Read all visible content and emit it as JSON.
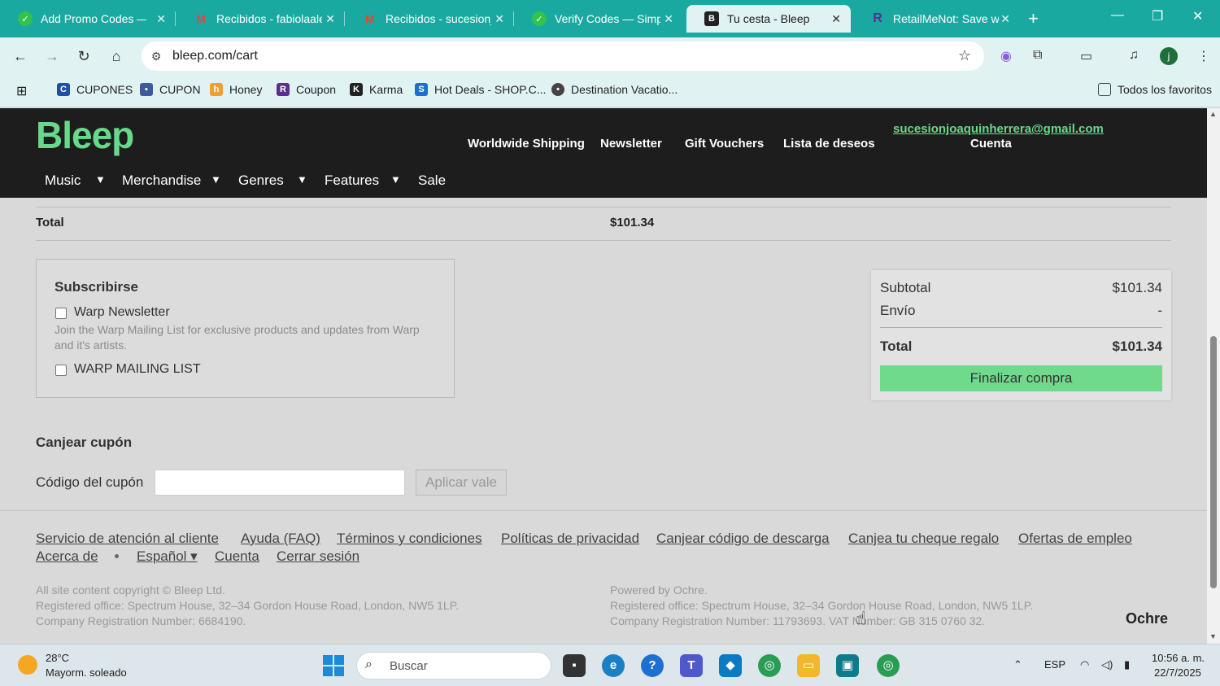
{
  "browser": {
    "tabs": [
      {
        "title": "Add Promo Codes — S",
        "icon": "honey-icon",
        "color": "#33c24d"
      },
      {
        "title": "Recibidos - fabiolaale",
        "icon": "gmail-icon",
        "color": "#ea4335"
      },
      {
        "title": "Recibidos - sucesionjo",
        "icon": "gmail-icon",
        "color": "#ea4335"
      },
      {
        "title": "Verify Codes — Simply",
        "icon": "honey-icon",
        "color": "#33c24d"
      },
      {
        "title": "Tu cesta - Bleep",
        "icon": "bleep-icon",
        "color": "#222222",
        "active": true
      },
      {
        "title": "RetailMeNot: Save wit",
        "icon": "retailmenot-icon",
        "color": "#5b2d90"
      }
    ],
    "url": "bleep.com/cart",
    "profile_initial": "j",
    "bookmarks": [
      {
        "label": "CUPONES",
        "icon": "cupones-icon"
      },
      {
        "label": "CUPON",
        "icon": "lock-icon"
      },
      {
        "label": "Honey",
        "icon": "honey-icon"
      },
      {
        "label": "Coupon",
        "icon": "retailmenot-icon"
      },
      {
        "label": "Karma",
        "icon": "karma-icon"
      },
      {
        "label": "Hot Deals - SHOP.C...",
        "icon": "shop-icon"
      },
      {
        "label": "Destination Vacatio...",
        "icon": "pin-icon"
      }
    ],
    "all_bookmarks": "Todos los favoritos"
  },
  "site": {
    "logo": "Bleep",
    "top_links": [
      "Worldwide Shipping",
      "Newsletter",
      "Gift Vouchers",
      "Lista de deseos"
    ],
    "account_email": "sucesionjoaquinherrera@gmail.com",
    "account_label": "Cuenta",
    "nav": [
      "Music",
      "Merchandise",
      "Genres",
      "Features",
      "Sale"
    ]
  },
  "cart": {
    "total_label": "Total",
    "total_value": "$101.34"
  },
  "subscribe": {
    "title": "Subscribirse",
    "options": [
      {
        "label": "Warp Newsletter",
        "checked": false
      },
      {
        "label": "WARP MAILING LIST",
        "checked": false
      }
    ],
    "description": "Join the Warp Mailing List for exclusive products and updates from Warp and it's artists."
  },
  "summary": {
    "subtotal_label": "Subtotal",
    "subtotal_value": "$101.34",
    "shipping_label": "Envío",
    "shipping_value": "-",
    "total_label": "Total",
    "total_value": "$101.34",
    "checkout_label": "Finalizar compra"
  },
  "coupon": {
    "title": "Canjear cupón",
    "label": "Código del cupón",
    "value": "",
    "button": "Aplicar vale"
  },
  "footer": {
    "links_row1": [
      "Servicio de atención al cliente",
      "Ayuda (FAQ)",
      "Términos y condiciones",
      "Políticas de privacidad",
      "Canjear código de descarga",
      "Canjea tu cheque regalo",
      "Ofertas de empleo"
    ],
    "links_row2": [
      "Acerca de",
      "Español ▾",
      "Cuenta",
      "Cerrar sesión"
    ],
    "left_lines": [
      "All site content copyright © Bleep Ltd.",
      "Registered office: Spectrum House, 32–34 Gordon House Road, London, NW5 1LP.",
      "Company Registration Number: 6684190."
    ],
    "right_lines": [
      "Powered by Ochre.",
      "Registered office: Spectrum House, 32–34 Gordon House Road, London, NW5 1LP.",
      "Company Registration Number: 11793693. VAT Number: GB 315 0760 32."
    ],
    "ochre_logo": "Ochre"
  },
  "taskbar": {
    "temp": "28°C",
    "weather": "Mayorm. soleado",
    "search_placeholder": "Buscar",
    "lang": "ESP",
    "time": "10:56 a. m.",
    "date": "22/7/2025"
  },
  "colors": {
    "brand": "#66d98a",
    "chrome": "#1aa9a0",
    "header": "#1d1d1d"
  }
}
